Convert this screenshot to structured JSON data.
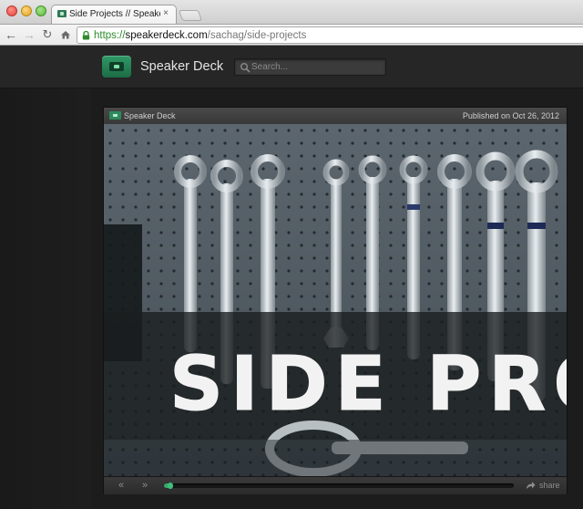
{
  "browser": {
    "tab": {
      "title": "Side Projects // Speaker Deck",
      "close": "×"
    },
    "address": {
      "scheme": "https://",
      "host": "speakerdeck.com",
      "path": "/sachag/side-projects"
    },
    "icons": [
      "back-icon",
      "forward-icon",
      "reload-icon",
      "home-icon",
      "lock-icon"
    ],
    "colors": {
      "scheme_green": "#2c8a2c"
    }
  },
  "header": {
    "site_name": "Speaker Deck",
    "search": {
      "placeholder": "Search...",
      "value": ""
    },
    "colors": {
      "brand_green": "#2e8a5c"
    }
  },
  "player": {
    "brand": "Speaker Deck",
    "published": "Published on Oct 26, 2012",
    "slide": {
      "title_text": "SIDE PROJE"
    },
    "controls": {
      "prev": "«",
      "next": "»",
      "share_label": "share"
    },
    "progress": 0.02
  }
}
